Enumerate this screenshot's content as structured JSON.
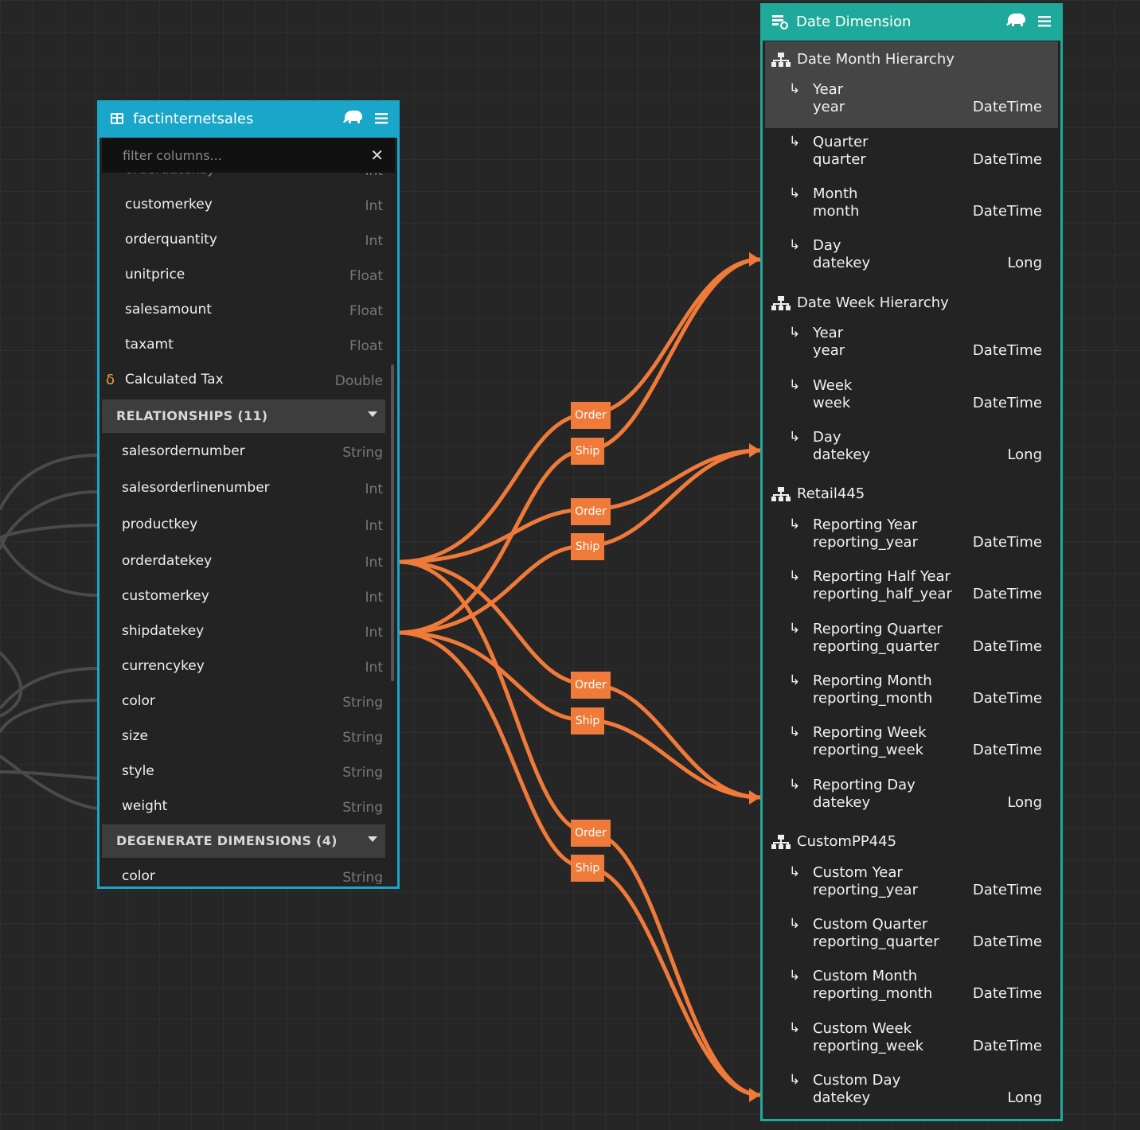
{
  "fact_table": {
    "title": "factinternetsales",
    "filter_placeholder": "filter columns...",
    "columns": [
      {
        "name": "customerkey",
        "type": "Int"
      },
      {
        "name": "orderquantity",
        "type": "Int"
      },
      {
        "name": "unitprice",
        "type": "Float"
      },
      {
        "name": "salesamount",
        "type": "Float"
      },
      {
        "name": "taxamt",
        "type": "Float"
      },
      {
        "name": "Calculated Tax",
        "type": "Double"
      }
    ],
    "relationships_title": "RELATIONSHIPS (11)",
    "relationships": [
      {
        "name": "salesordernumber",
        "type": "String"
      },
      {
        "name": "salesorderlinenumber",
        "type": "Int"
      },
      {
        "name": "productkey",
        "type": "Int"
      },
      {
        "name": "orderdatekey",
        "type": "Int"
      },
      {
        "name": "customerkey",
        "type": "Int"
      },
      {
        "name": "shipdatekey",
        "type": "Int"
      },
      {
        "name": "currencykey",
        "type": "Int"
      },
      {
        "name": "color",
        "type": "String"
      },
      {
        "name": "size",
        "type": "String"
      },
      {
        "name": "style",
        "type": "String"
      },
      {
        "name": "weight",
        "type": "String"
      }
    ],
    "degenerate_title": "DEGENERATE DIMENSIONS (4)",
    "degenerate": [
      {
        "name": "color",
        "type": "String"
      }
    ]
  },
  "date_dimension": {
    "title": "Date Dimension",
    "hierarchies": [
      {
        "title": "Date Month Hierarchy",
        "levels": [
          {
            "name": "Year",
            "column": "year",
            "type": "DateTime"
          },
          {
            "name": "Quarter",
            "column": "quarter",
            "type": "DateTime"
          },
          {
            "name": "Month",
            "column": "month",
            "type": "DateTime"
          },
          {
            "name": "Day",
            "column": "datekey",
            "type": "Long"
          }
        ]
      },
      {
        "title": "Date Week Hierarchy",
        "levels": [
          {
            "name": "Year",
            "column": "year",
            "type": "DateTime"
          },
          {
            "name": "Week",
            "column": "week",
            "type": "DateTime"
          },
          {
            "name": "Day",
            "column": "datekey",
            "type": "Long"
          }
        ]
      },
      {
        "title": "Retail445",
        "levels": [
          {
            "name": "Reporting Year",
            "column": "reporting_year",
            "type": "DateTime"
          },
          {
            "name": "Reporting Half Year",
            "column": "reporting_half_year",
            "type": "DateTime"
          },
          {
            "name": "Reporting Quarter",
            "column": "reporting_quarter",
            "type": "DateTime"
          },
          {
            "name": "Reporting Month",
            "column": "reporting_month",
            "type": "DateTime"
          },
          {
            "name": "Reporting Week",
            "column": "reporting_week",
            "type": "DateTime"
          },
          {
            "name": "Reporting Day",
            "column": "datekey",
            "type": "Long"
          }
        ]
      },
      {
        "title": "CustomPP445",
        "levels": [
          {
            "name": "Custom Year",
            "column": "reporting_year",
            "type": "DateTime"
          },
          {
            "name": "Custom Quarter",
            "column": "reporting_quarter",
            "type": "DateTime"
          },
          {
            "name": "Custom Month",
            "column": "reporting_month",
            "type": "DateTime"
          },
          {
            "name": "Custom Week",
            "column": "reporting_week",
            "type": "DateTime"
          },
          {
            "name": "Custom Day",
            "column": "datekey",
            "type": "Long"
          }
        ]
      }
    ]
  },
  "link_labels": [
    "Order",
    "Ship",
    "Order",
    "Ship",
    "Order",
    "Ship",
    "Order",
    "Ship"
  ],
  "colors": {
    "fact_accent": "#19a6c9",
    "dim_accent": "#1fa99a",
    "link": "#ef7a39",
    "background": "#262626"
  },
  "icons": {
    "table": "table-icon",
    "dimension": "calendar-icon",
    "hierarchy": "hierarchy-icon",
    "level": "level-arrow-icon",
    "calculated": "delta-icon",
    "tile": "elephant-icon",
    "menu": "menu-icon",
    "clear": "close-icon",
    "collapse": "chevron-down-icon"
  }
}
